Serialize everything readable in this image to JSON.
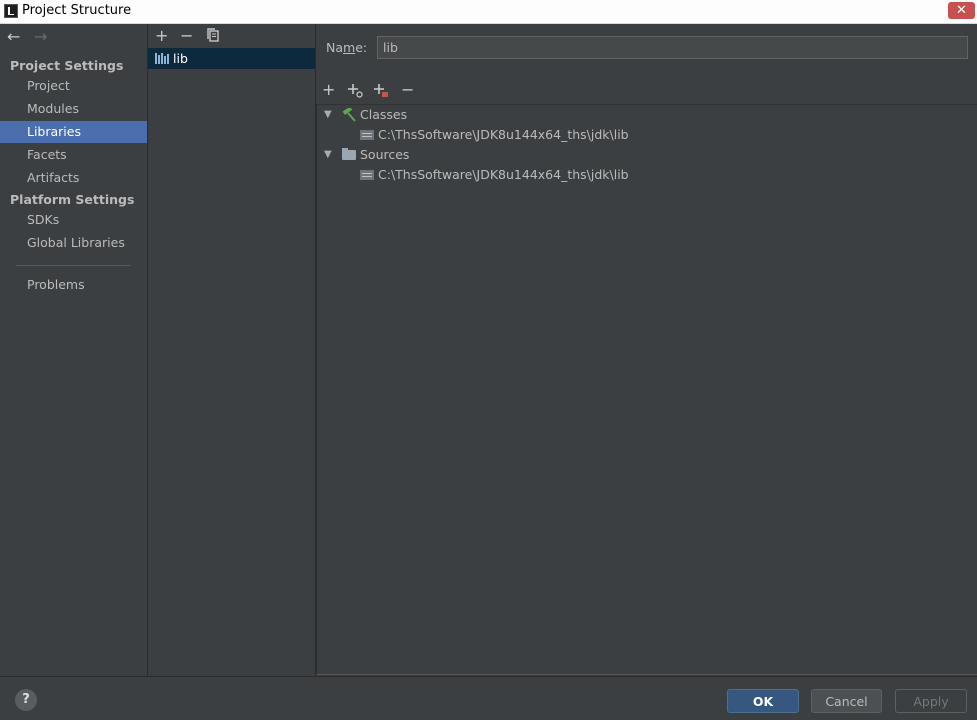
{
  "window": {
    "title": "Project Structure",
    "close_symbol": "✕"
  },
  "sidebar": {
    "back_symbol": "←",
    "forward_symbol": "→",
    "project_settings_header": "Project Settings",
    "project_items": [
      "Project",
      "Modules",
      "Libraries",
      "Facets",
      "Artifacts"
    ],
    "platform_settings_header": "Platform Settings",
    "platform_items": [
      "SDKs",
      "Global Libraries"
    ],
    "problems_label": "Problems",
    "selected": "Libraries"
  },
  "libraries": {
    "toolbar": {
      "add": "+",
      "remove": "−"
    },
    "items": [
      {
        "label": "lib"
      }
    ]
  },
  "detail": {
    "name_label_prefix": "Na",
    "name_label_mnemonic": "m",
    "name_label_suffix": "e:",
    "name_value": "lib",
    "toolbar": {
      "add": "+",
      "remove": "−"
    },
    "tree": {
      "classes": {
        "label": "Classes",
        "path": "C:\\ThsSoftware\\JDK8u144x64_ths\\jdk\\lib"
      },
      "sources": {
        "label": "Sources",
        "path": "C:\\ThsSoftware\\JDK8u144x64_ths\\jdk\\lib"
      }
    }
  },
  "footer": {
    "help": "?",
    "ok": "OK",
    "cancel": "Cancel",
    "apply": "Apply"
  },
  "colors": {
    "background": "#3c3f41",
    "selection": "#4b6eaf",
    "list_selection": "#0d293e",
    "ok_button": "#365880",
    "classes_icon_green": "#5fa450",
    "add_badge_red": "#c75450"
  }
}
